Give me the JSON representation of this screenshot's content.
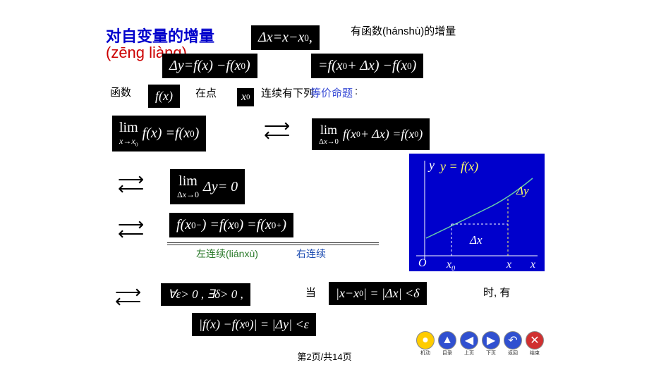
{
  "title": "对自变量的增量",
  "pinyin": "(zēng liàng)",
  "hasFunctionIncrement": "有函数(hánshù)的增量",
  "eq_dx": "Δx = x − x₀ ,",
  "eq_dy": "Δy = f(x) − f(x₀)",
  "eq_dy2": "= f(x₀ + Δx) − f(x₀)",
  "label_func": "函数",
  "label_fx": "f(x)",
  "label_at": "在点",
  "label_x0": "x₀",
  "label_cont": "连续有下列",
  "label_equiv": "等价命题",
  "colon": ":",
  "eq_lim1": "lim_{x→x₀} f(x) = f(x₀)",
  "eq_lim2": "lim_{Δx→0} f(x₀ + Δx) = f(x₀)",
  "eq_lim3": "lim_{Δx→0} Δy = 0",
  "eq_sided": "f(x₀⁻) = f(x₀) = f(x₀⁺)",
  "label_left_cont": "左连续(liánxù)",
  "label_right_cont": "右连续",
  "eq_eps1": "∀ε > 0 , ∃δ > 0 ,",
  "label_when": "当",
  "eq_eps2": "|x − x₀| = |Δx| < δ",
  "label_then": "时, 有",
  "eq_eps3": "|f(x) − f(x₀)| = |Δy| < ε",
  "footer": "第2页/共14页",
  "chart": {
    "ylabel": "y",
    "curve": "y = f(x)",
    "dy": "Δy",
    "dx": "Δx",
    "o": "O",
    "x0": "x₀",
    "x": "x",
    "x2": "x"
  },
  "nav": {
    "items": [
      {
        "id": "auto",
        "label": "机动",
        "sym": "●",
        "bg": "#ffcc00"
      },
      {
        "id": "toc",
        "label": "目录",
        "sym": "▲",
        "bg": "#3050d0"
      },
      {
        "id": "prev",
        "label": "上页",
        "sym": "◀",
        "bg": "#3050d0"
      },
      {
        "id": "next",
        "label": "下页",
        "sym": "▶",
        "bg": "#3050d0"
      },
      {
        "id": "back",
        "label": "返回",
        "sym": "↶",
        "bg": "#3050d0"
      },
      {
        "id": "end",
        "label": "结束",
        "sym": "✕",
        "bg": "#d03030"
      }
    ]
  }
}
